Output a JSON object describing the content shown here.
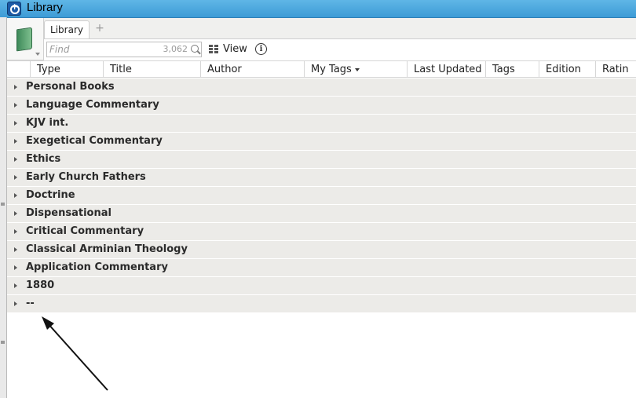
{
  "window": {
    "title": "Library"
  },
  "tabs": [
    {
      "label": "Library"
    }
  ],
  "tab_add_label": "+",
  "toolbar": {
    "find_placeholder": "Find",
    "find_count": "3,062",
    "view_label": "View",
    "info_label": "i"
  },
  "columns": [
    "Type",
    "Title",
    "Author",
    "My Tags",
    "Last Updated",
    "Tags",
    "Edition",
    "Ratin"
  ],
  "groups": [
    "Personal Books",
    "Language Commentary",
    "KJV int.",
    "Exegetical Commentary",
    "Ethics",
    "Early Church Fathers",
    "Doctrine",
    "Dispensational",
    "Critical Commentary",
    "Classical Arminian Theology",
    "Application Commentary",
    "1880",
    "--"
  ],
  "icons": {
    "app": "logos-app-icon",
    "library": "book-icon",
    "search": "search-icon",
    "view": "grid-icon",
    "info": "info-icon",
    "expander": "triangle-right-icon",
    "sort": "caret-down-icon"
  }
}
